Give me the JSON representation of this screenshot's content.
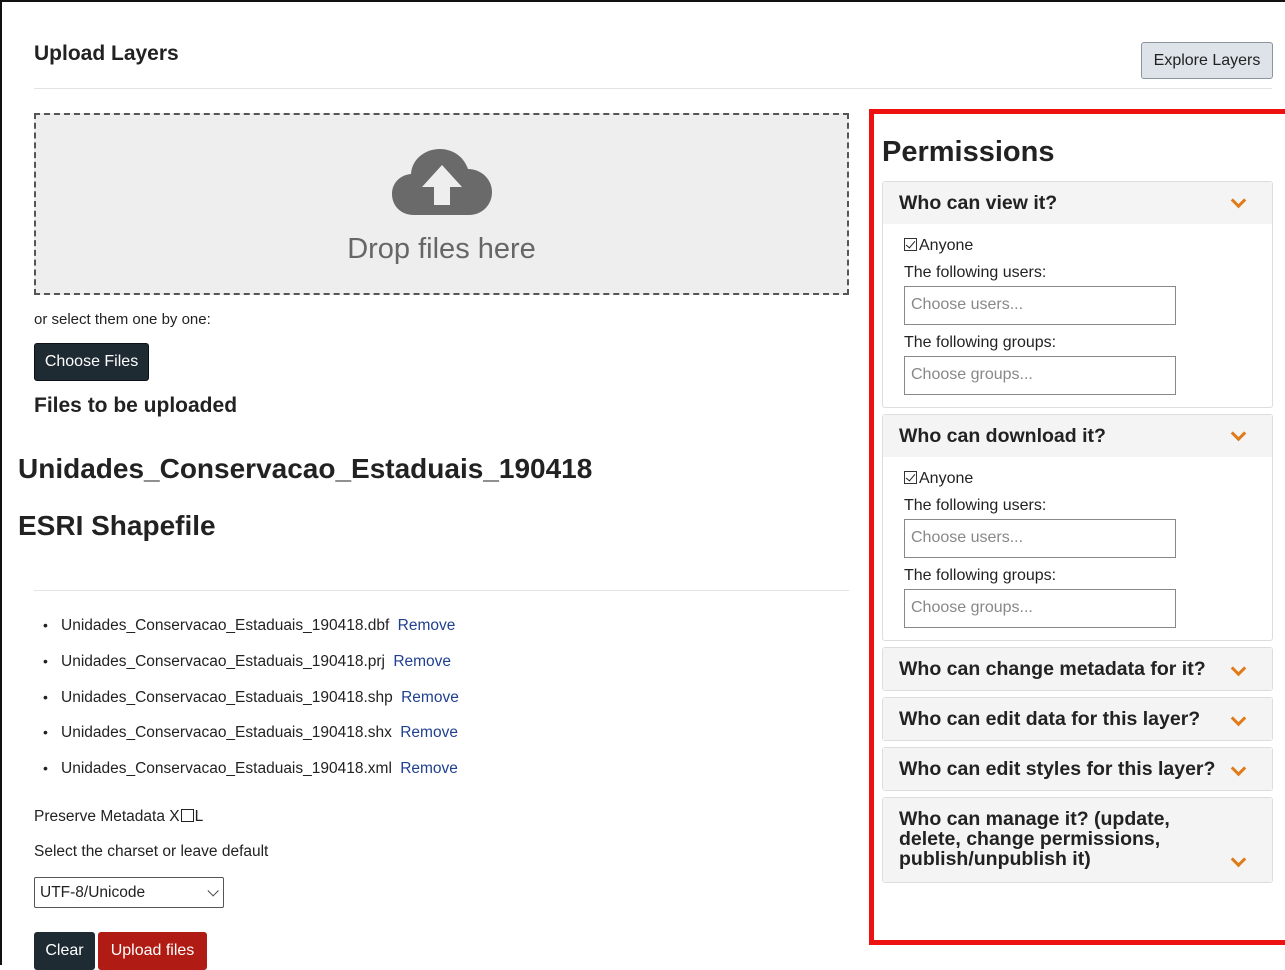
{
  "header": {
    "title": "Upload Layers",
    "explore_label": "Explore Layers"
  },
  "upload": {
    "drop_text": "Drop files here",
    "select_hint": "or select them one by one:",
    "choose_files_label": "Choose Files",
    "files_heading": "Files to be uploaded",
    "layer_name": "Unidades_Conservacao_Estaduais_190418",
    "layer_type": "ESRI Shapefile",
    "files": [
      {
        "name": "Unidades_Conservacao_Estaduais_190418.dbf",
        "remove": "Remove"
      },
      {
        "name": "Unidades_Conservacao_Estaduais_190418.prj",
        "remove": "Remove"
      },
      {
        "name": "Unidades_Conservacao_Estaduais_190418.shp",
        "remove": "Remove"
      },
      {
        "name": "Unidades_Conservacao_Estaduais_190418.shx",
        "remove": "Remove"
      },
      {
        "name": "Unidades_Conservacao_Estaduais_190418.xml",
        "remove": "Remove"
      }
    ],
    "preserve_prefix": "Preserve Metadata X",
    "preserve_suffix": "L",
    "preserve_checked": false,
    "charset_label": "Select the charset or leave default",
    "charset_value": "UTF-8/Unicode",
    "clear_label": "Clear",
    "upload_label": "Upload files"
  },
  "permissions": {
    "title": "Permissions",
    "sections": [
      {
        "title": "Who can view it?",
        "expanded": true,
        "anyone_label": "Anyone",
        "anyone_checked": true,
        "users_label": "The following users:",
        "users_placeholder": "Choose users...",
        "groups_label": "The following groups:",
        "groups_placeholder": "Choose groups..."
      },
      {
        "title": "Who can download it?",
        "expanded": true,
        "anyone_label": "Anyone",
        "anyone_checked": true,
        "users_label": "The following users:",
        "users_placeholder": "Choose users...",
        "groups_label": "The following groups:",
        "groups_placeholder": "Choose groups..."
      },
      {
        "title": "Who can change metadata for it?",
        "expanded": false
      },
      {
        "title": "Who can edit data for this layer?",
        "expanded": false
      },
      {
        "title": "Who can edit styles for this layer?",
        "expanded": false
      },
      {
        "title": "Who can manage it? (update, delete, change permissions, publish/unpublish it)",
        "expanded": false
      }
    ]
  },
  "colors": {
    "highlight_border": "#ee1111",
    "chevron": "#e07b1a",
    "upload_button": "#b01c14",
    "dark_button": "#1f2b33",
    "link": "#1f3f8f"
  },
  "icons": {
    "cloud": "cloud-upload-icon",
    "chevron": "chevron-down-icon",
    "checkbox": "checkbox-icon"
  }
}
